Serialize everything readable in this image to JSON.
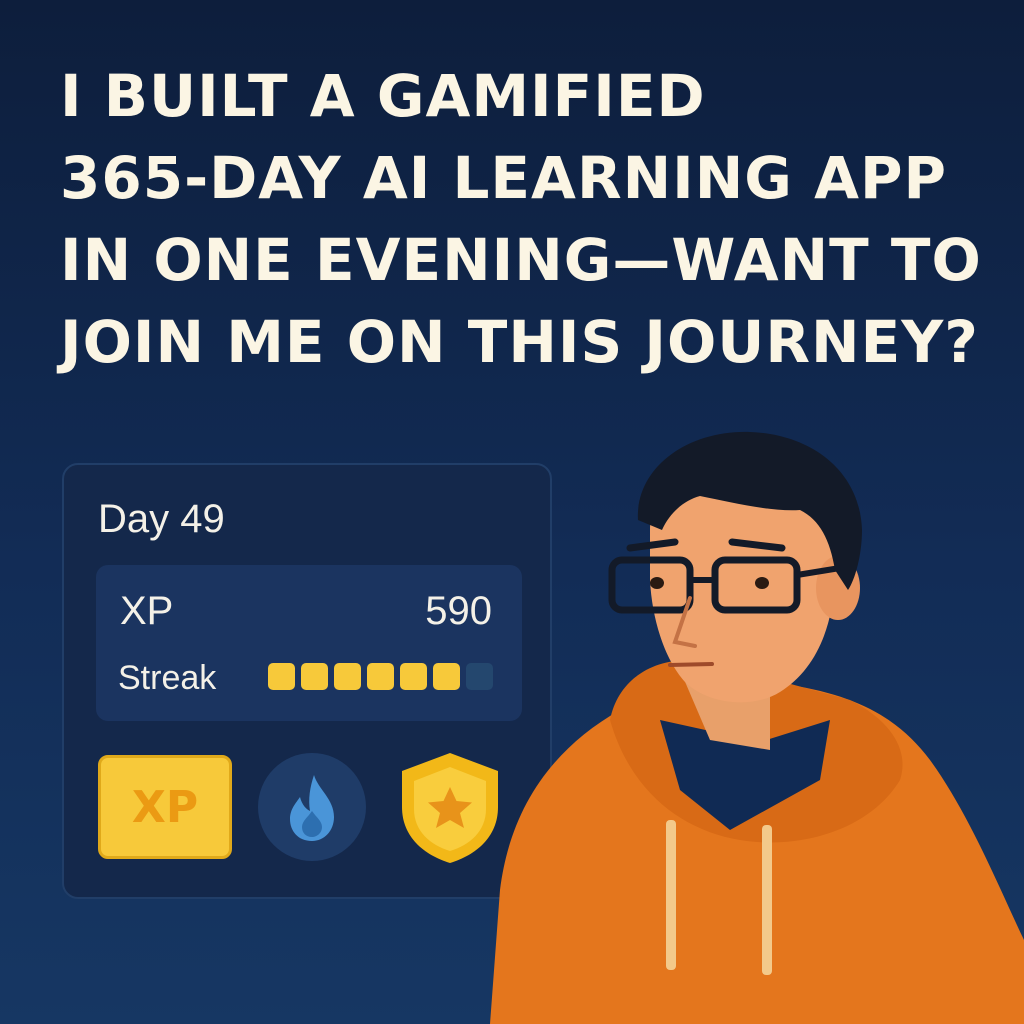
{
  "headline": {
    "lines": [
      "I BUILT A GAMIFIED",
      "365-DAY AI LEARNING APP",
      "IN ONE EVENING—WANT TO",
      "JOIN ME ON THIS JOURNEY?"
    ]
  },
  "card": {
    "day_label": "Day 49",
    "xp_label": "XP",
    "xp_value": "590",
    "streak_label": "Streak",
    "streak_filled": 6,
    "streak_total": 7,
    "badges": {
      "xp_badge_text": "XP",
      "flame_icon": "flame-icon",
      "shield_icon": "shield-star-icon"
    }
  },
  "colors": {
    "background": "#0d1e3c",
    "headline": "#fbf5e4",
    "card": "#14284b",
    "streak_on": "#f7c93a",
    "streak_off": "#24476e",
    "hoodie": "#e4761d",
    "flame": "#4a95d8"
  }
}
